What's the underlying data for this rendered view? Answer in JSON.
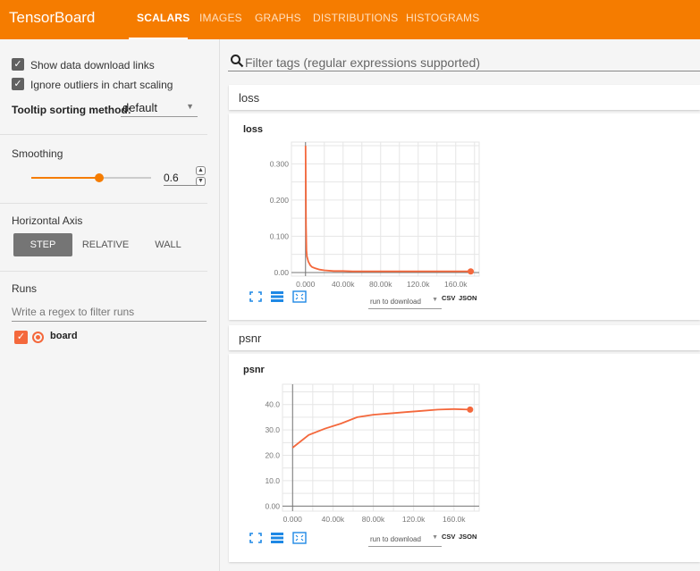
{
  "app": {
    "title": "TensorBoard"
  },
  "tabs": [
    {
      "label": "SCALARS",
      "active": true
    },
    {
      "label": "IMAGES"
    },
    {
      "label": "GRAPHS"
    },
    {
      "label": "DISTRIBUTIONS"
    },
    {
      "label": "HISTOGRAMS"
    }
  ],
  "sidebar": {
    "show_download_links": {
      "label": "Show data download links",
      "checked": true
    },
    "ignore_outliers": {
      "label": "Ignore outliers in chart scaling",
      "checked": true
    },
    "tooltip_sort": {
      "label": "Tooltip sorting method:",
      "value": "default"
    },
    "smoothing": {
      "title": "Smoothing",
      "value": "0.6",
      "level": 0.6
    },
    "horizontal_axis": {
      "title": "Horizontal Axis",
      "options": [
        "STEP",
        "RELATIVE",
        "WALL"
      ],
      "selected": "STEP"
    },
    "runs": {
      "title": "Runs",
      "filter_placeholder": "Write a regex to filter runs",
      "items": [
        {
          "label": "board",
          "checked": true
        }
      ]
    }
  },
  "search": {
    "placeholder": "Filter tags (regular expressions supported)"
  },
  "colors": {
    "accent": "#f57c00",
    "series": "#f4683c"
  },
  "icons": [
    "search-icon",
    "fullscreen-icon",
    "log-scale-icon",
    "fit-domain-icon",
    "checkmark-icon",
    "chevron-down-icon"
  ],
  "categories": [
    {
      "name": "loss",
      "chart_title": "loss",
      "download_select": "run to download",
      "formats": [
        "CSV",
        "JSON"
      ]
    },
    {
      "name": "psnr",
      "chart_title": "psnr",
      "download_select": "run to download",
      "formats": [
        "CSV",
        "JSON"
      ]
    }
  ],
  "chart_data": [
    {
      "type": "line",
      "title": "loss",
      "xlabel": "",
      "ylabel": "",
      "xlim": [
        -15000,
        185000
      ],
      "ylim": [
        -0.01,
        0.36
      ],
      "xticks": [
        0,
        40000,
        80000,
        120000,
        160000
      ],
      "xtick_labels": [
        "0.000",
        "40.00k",
        "80.00k",
        "120.0k",
        "160.0k"
      ],
      "yticks": [
        0,
        0.1,
        0.2,
        0.3
      ],
      "ytick_labels": [
        "0.00",
        "0.100",
        "0.200",
        "0.300"
      ],
      "grid": true,
      "series": [
        {
          "run": "board",
          "color": "#f4683c",
          "x": [
            0,
            500,
            1000,
            1500,
            2000,
            3000,
            4000,
            5000,
            7000,
            10000,
            15000,
            20000,
            30000,
            40000,
            50000,
            60000,
            80000,
            100000,
            120000,
            140000,
            160000,
            176000
          ],
          "y": [
            0.35,
            0.13,
            0.06,
            0.045,
            0.04,
            0.03,
            0.025,
            0.02,
            0.015,
            0.012,
            0.008,
            0.006,
            0.004,
            0.004,
            0.003,
            0.003,
            0.003,
            0.003,
            0.003,
            0.003,
            0.003,
            0.003
          ]
        }
      ]
    },
    {
      "type": "line",
      "title": "psnr",
      "xlabel": "",
      "ylabel": "",
      "xlim": [
        -10000,
        185000
      ],
      "ylim": [
        -2,
        48
      ],
      "xticks": [
        0,
        40000,
        80000,
        120000,
        160000
      ],
      "xtick_labels": [
        "0.000",
        "40.00k",
        "80.00k",
        "120.0k",
        "160.0k"
      ],
      "yticks": [
        0,
        10,
        20,
        30,
        40
      ],
      "ytick_labels": [
        "0.00",
        "10.0",
        "20.0",
        "30.0",
        "40.0"
      ],
      "grid": true,
      "series": [
        {
          "run": "board",
          "color": "#f4683c",
          "x": [
            0,
            16000,
            32000,
            48000,
            64000,
            80000,
            96000,
            112000,
            128000,
            144000,
            160000,
            176000
          ],
          "y": [
            23,
            28,
            30.5,
            32.5,
            35,
            36,
            36.5,
            37,
            37.5,
            38,
            38.2,
            38
          ]
        }
      ]
    }
  ]
}
